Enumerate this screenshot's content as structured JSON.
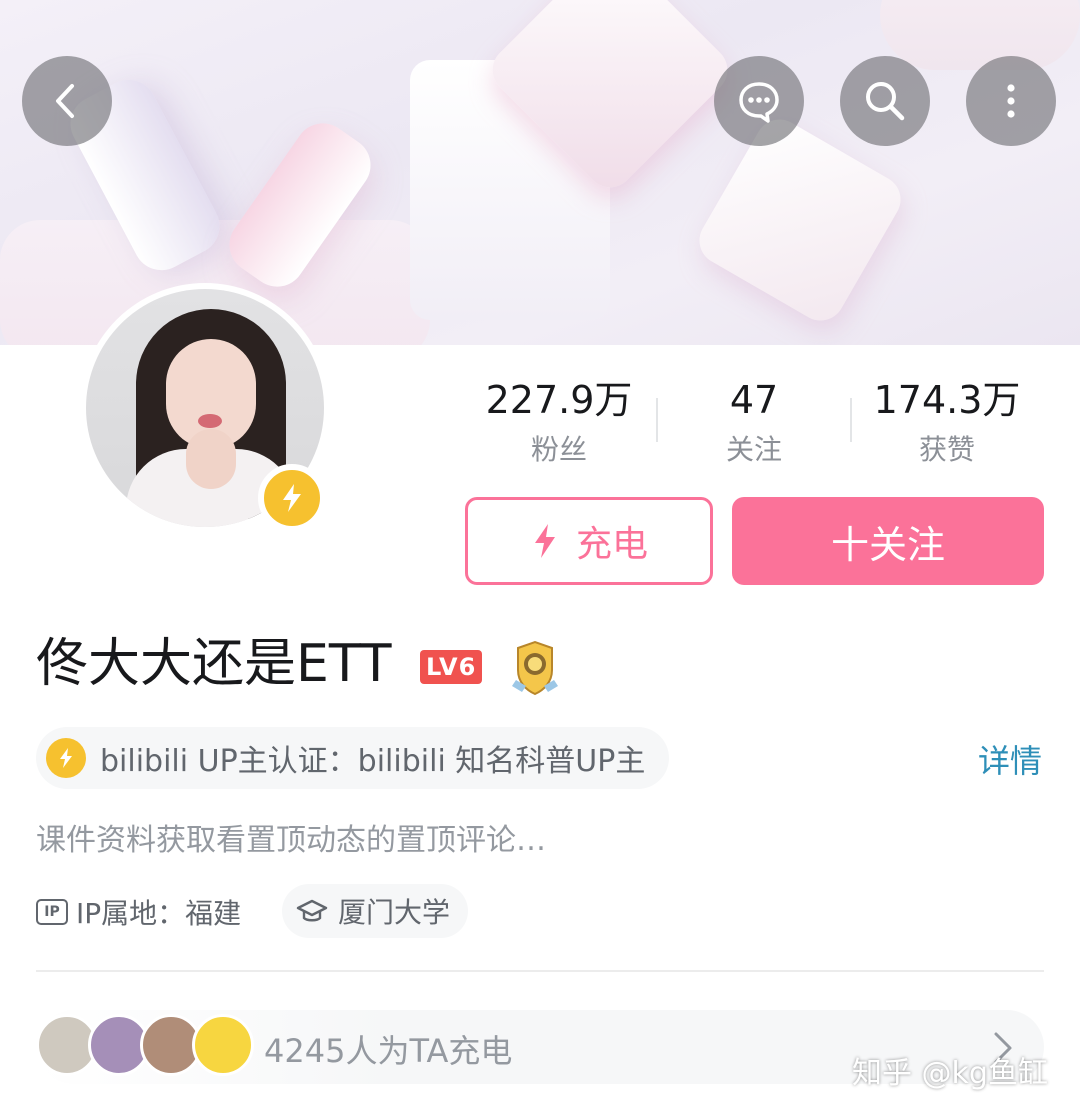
{
  "profile": {
    "name": "佟大大还是ETT",
    "level": "LV6",
    "verification": "bilibili UP主认证：bilibili 知名科普UP主",
    "details_link": "详情",
    "bio": "课件资料获取看置顶动态的置顶评论…",
    "ip_label": "IP属地：福建",
    "ip_icon_text": "IP",
    "school": "厦门大学"
  },
  "stats": [
    {
      "value": "227.9万",
      "label": "粉丝"
    },
    {
      "value": "47",
      "label": "关注"
    },
    {
      "value": "174.3万",
      "label": "获赞"
    }
  ],
  "actions": {
    "charge_label": "充电",
    "follow_label": "十关注"
  },
  "supporters": {
    "count": "4245",
    "suffix": "人为TA充电"
  },
  "watermark": "知乎 @kg鱼缸",
  "icons": {
    "back": "chevron-left-icon",
    "message": "chat-bubble-icon",
    "search": "search-icon",
    "more": "more-vertical-icon"
  },
  "colors": {
    "accent": "#fb7299",
    "badge_yellow": "#f6c12f",
    "level_red": "#f0524f",
    "link_blue": "#2e8fb8"
  }
}
